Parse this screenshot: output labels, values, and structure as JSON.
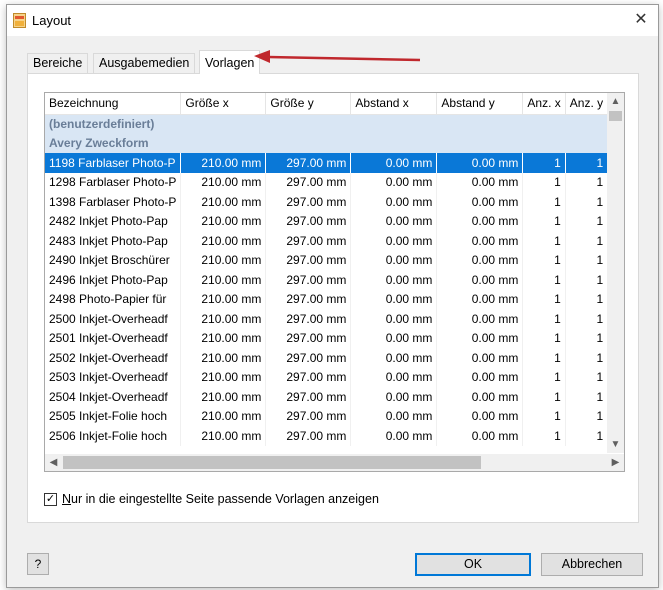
{
  "window": {
    "title": "Layout",
    "close": "✕"
  },
  "tabs": [
    {
      "label": "Bereiche"
    },
    {
      "label": "Ausgabemedien"
    },
    {
      "label": "Vorlagen"
    }
  ],
  "active_tab": "Vorlagen",
  "table": {
    "columns": [
      "Bezeichnung",
      "Größe x",
      "Größe y",
      "Abstand x",
      "Abstand y",
      "Anz. x",
      "Anz. y"
    ],
    "rows": [
      {
        "type": "group",
        "cells": [
          "(benutzerdefiniert)"
        ]
      },
      {
        "type": "group",
        "cells": [
          "Avery Zweckform"
        ]
      },
      {
        "type": "row",
        "selected": true,
        "cells": [
          "1198 Farblaser Photo-P",
          "210.00 mm",
          "297.00 mm",
          "0.00 mm",
          "0.00 mm",
          "1",
          "1"
        ]
      },
      {
        "type": "row",
        "cells": [
          "1298 Farblaser Photo-P",
          "210.00 mm",
          "297.00 mm",
          "0.00 mm",
          "0.00 mm",
          "1",
          "1"
        ]
      },
      {
        "type": "row",
        "cells": [
          "1398 Farblaser Photo-P",
          "210.00 mm",
          "297.00 mm",
          "0.00 mm",
          "0.00 mm",
          "1",
          "1"
        ]
      },
      {
        "type": "row",
        "cells": [
          "2482 Inkjet Photo-Pap",
          "210.00 mm",
          "297.00 mm",
          "0.00 mm",
          "0.00 mm",
          "1",
          "1"
        ]
      },
      {
        "type": "row",
        "cells": [
          "2483 Inkjet Photo-Pap",
          "210.00 mm",
          "297.00 mm",
          "0.00 mm",
          "0.00 mm",
          "1",
          "1"
        ]
      },
      {
        "type": "row",
        "cells": [
          "2490 Inkjet Broschürer",
          "210.00 mm",
          "297.00 mm",
          "0.00 mm",
          "0.00 mm",
          "1",
          "1"
        ]
      },
      {
        "type": "row",
        "cells": [
          "2496 Inkjet Photo-Pap",
          "210.00 mm",
          "297.00 mm",
          "0.00 mm",
          "0.00 mm",
          "1",
          "1"
        ]
      },
      {
        "type": "row",
        "cells": [
          "2498 Photo-Papier für",
          "210.00 mm",
          "297.00 mm",
          "0.00 mm",
          "0.00 mm",
          "1",
          "1"
        ]
      },
      {
        "type": "row",
        "cells": [
          "2500 Inkjet-Overheadf",
          "210.00 mm",
          "297.00 mm",
          "0.00 mm",
          "0.00 mm",
          "1",
          "1"
        ]
      },
      {
        "type": "row",
        "cells": [
          "2501 Inkjet-Overheadf",
          "210.00 mm",
          "297.00 mm",
          "0.00 mm",
          "0.00 mm",
          "1",
          "1"
        ]
      },
      {
        "type": "row",
        "cells": [
          "2502 Inkjet-Overheadf",
          "210.00 mm",
          "297.00 mm",
          "0.00 mm",
          "0.00 mm",
          "1",
          "1"
        ]
      },
      {
        "type": "row",
        "cells": [
          "2503 Inkjet-Overheadf",
          "210.00 mm",
          "297.00 mm",
          "0.00 mm",
          "0.00 mm",
          "1",
          "1"
        ]
      },
      {
        "type": "row",
        "cells": [
          "2504 Inkjet-Overheadf",
          "210.00 mm",
          "297.00 mm",
          "0.00 mm",
          "0.00 mm",
          "1",
          "1"
        ]
      },
      {
        "type": "row",
        "cells": [
          "2505 Inkjet-Folie hoch",
          "210.00 mm",
          "297.00 mm",
          "0.00 mm",
          "0.00 mm",
          "1",
          "1"
        ]
      },
      {
        "type": "row",
        "cells": [
          "2506 Inkjet-Folie hoch",
          "210.00 mm",
          "297.00 mm",
          "0.00 mm",
          "0.00 mm",
          "1",
          "1"
        ]
      }
    ]
  },
  "checkbox": {
    "checked": true,
    "mark": "✓",
    "mnemonic": "N",
    "label_rest": "ur in die eingestellte Seite passende Vorlagen anzeigen"
  },
  "buttons": {
    "help": "?",
    "ok": "OK",
    "cancel": "Abbrechen"
  },
  "icons": {
    "app": "layout-app-icon",
    "arrow": "red-arrow-annotation",
    "scroll_up": "▲",
    "scroll_down": "▼",
    "scroll_left": "◀",
    "scroll_right": "▶"
  },
  "colors": {
    "selection": "#0a78d7",
    "group_row": "#d9e6f4",
    "arrow": "#c0282d",
    "ok_border": "#0078d7"
  }
}
